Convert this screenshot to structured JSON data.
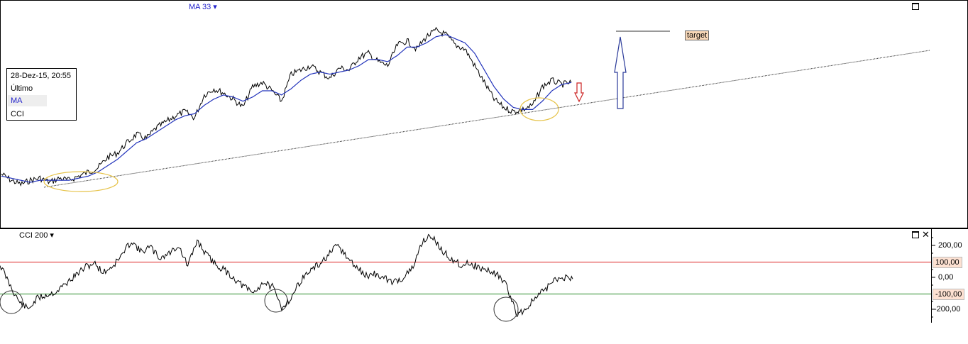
{
  "price_panel": {
    "indicator_label": "MA 33",
    "legend": {
      "date": "28-Dez-15, 20:55",
      "rows": [
        "Último",
        "MA",
        "CCI"
      ]
    },
    "annotation_label": "target"
  },
  "cci_panel": {
    "indicator_label": "CCI 200",
    "axis_labels": [
      "200,00",
      "0,00",
      "-200,00"
    ],
    "level_labels": [
      "100,00",
      "-100,00"
    ]
  },
  "colors": {
    "price": "#000000",
    "ma": "#2233bb",
    "upper_level": "#dd2222",
    "lower_level": "#228822",
    "oval": "#e6c34a",
    "up_arrow": "#2a3a99",
    "down_arrow": "#cc2222"
  },
  "chart_data": [
    {
      "type": "line",
      "title": "",
      "series": [
        {
          "name": "Último",
          "values": [
            0.3,
            0.27,
            0.25,
            0.27,
            0.28,
            0.26,
            0.28,
            0.27,
            0.29,
            0.31,
            0.33,
            0.38,
            0.4,
            0.45,
            0.49,
            0.47,
            0.52,
            0.55,
            0.58,
            0.6,
            0.57,
            0.68,
            0.71,
            0.69,
            0.66,
            0.62,
            0.72,
            0.74,
            0.7,
            0.65,
            0.78,
            0.8,
            0.82,
            0.79,
            0.76,
            0.81,
            0.8,
            0.86,
            0.88,
            0.84,
            0.82,
            0.92,
            0.94,
            0.9,
            0.96,
            0.99,
            0.97,
            0.92,
            0.9,
            0.82,
            0.74,
            0.66,
            0.62,
            0.6,
            0.61,
            0.63,
            0.72,
            0.75,
            0.73,
            0.74
          ]
        },
        {
          "name": "MA",
          "values": [
            0.29,
            0.28,
            0.27,
            0.26,
            0.27,
            0.27,
            0.27,
            0.27,
            0.28,
            0.29,
            0.31,
            0.34,
            0.37,
            0.41,
            0.45,
            0.47,
            0.5,
            0.53,
            0.56,
            0.58,
            0.59,
            0.63,
            0.66,
            0.68,
            0.67,
            0.65,
            0.67,
            0.7,
            0.7,
            0.68,
            0.71,
            0.75,
            0.78,
            0.79,
            0.78,
            0.79,
            0.8,
            0.82,
            0.85,
            0.85,
            0.84,
            0.87,
            0.91,
            0.91,
            0.93,
            0.96,
            0.97,
            0.95,
            0.93,
            0.88,
            0.8,
            0.72,
            0.66,
            0.62,
            0.61,
            0.61,
            0.65,
            0.7,
            0.73,
            0.74
          ]
        }
      ]
    },
    {
      "type": "line",
      "title": "",
      "ylim": [
        -270,
        290
      ],
      "series": [
        {
          "name": "CCI",
          "values": [
            80,
            -40,
            -150,
            -200,
            -130,
            -110,
            -90,
            -40,
            10,
            60,
            90,
            30,
            70,
            140,
            230,
            160,
            190,
            120,
            150,
            200,
            70,
            230,
            140,
            80,
            40,
            -10,
            -60,
            -100,
            -30,
            -60,
            -190,
            -130,
            -20,
            40,
            80,
            140,
            200,
            120,
            60,
            10,
            20,
            -10,
            -30,
            0,
            60,
            230,
            260,
            170,
            120,
            80,
            90,
            60,
            40,
            20,
            -60,
            -230,
            -200,
            -130,
            -80,
            -20,
            0,
            -10
          ]
        }
      ]
    }
  ]
}
